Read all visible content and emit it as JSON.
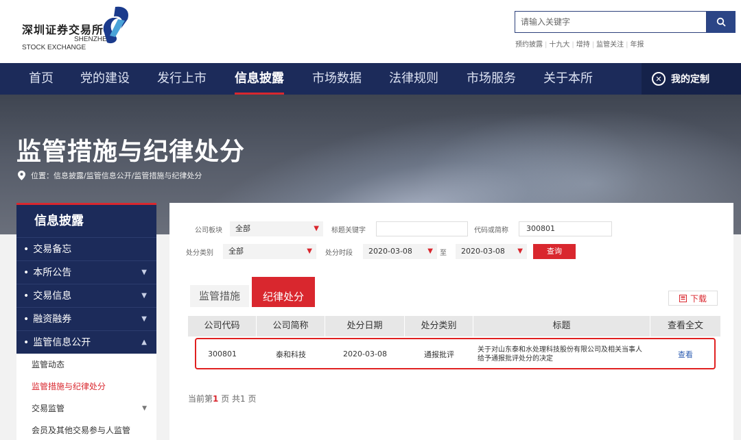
{
  "header": {
    "logo_cn": "深圳证券交易所",
    "logo_en1": "SHENZHEN",
    "logo_en2": "STOCK EXCHANGE",
    "search_placeholder": "请输入关键字",
    "quick_links": [
      "预约披露",
      "十九大",
      "增持",
      "监管关注",
      "年报"
    ]
  },
  "nav": {
    "items": [
      "首页",
      "党的建设",
      "发行上市",
      "信息披露",
      "市场数据",
      "法律规则",
      "市场服务",
      "关于本所"
    ],
    "active_index": 3,
    "custom": "我的定制"
  },
  "banner": {
    "title": "监管措施与纪律处分",
    "breadcrumb": "位置：信息披露/监管信息公开/监管措施与纪律处分"
  },
  "sidebar": {
    "head": "信息披露",
    "items": [
      {
        "label": "交易备忘",
        "arrow": ""
      },
      {
        "label": "本所公告",
        "arrow": "▼"
      },
      {
        "label": "交易信息",
        "arrow": "▼"
      },
      {
        "label": "融资融券",
        "arrow": "▼"
      },
      {
        "label": "监管信息公开",
        "arrow": "▲"
      }
    ],
    "sub_items": [
      {
        "label": "监管动态",
        "active": false,
        "arrow": ""
      },
      {
        "label": "监管措施与纪律处分",
        "active": true,
        "arrow": ""
      },
      {
        "label": "交易监管",
        "active": false,
        "arrow": "▼"
      },
      {
        "label": "会员及其他交易参与人监管",
        "active": false,
        "arrow": ""
      }
    ]
  },
  "filters": {
    "board_label": "公司板块",
    "board_value": "全部",
    "keyword_label": "标题关键字",
    "keyword_value": "",
    "code_label": "代码或简称",
    "code_value": "300801",
    "category_label": "处分类别",
    "category_value": "全部",
    "period_label": "处分时段",
    "date_from": "2020-03-08",
    "to_label": "至",
    "date_to": "2020-03-08",
    "query_button": "查询"
  },
  "tabs": {
    "inactive": "监管措施",
    "active": "纪律处分",
    "download": "下载"
  },
  "table": {
    "columns": [
      "公司代码",
      "公司简称",
      "处分日期",
      "处分类别",
      "标题",
      "查看全文"
    ],
    "rows": [
      {
        "code": "300801",
        "name": "泰和科技",
        "date": "2020-03-08",
        "category": "通报批评",
        "title": "关于对山东泰和水处理科技股份有限公司及相关当事人给予通报批评处分的决定",
        "view": "查看"
      }
    ]
  },
  "pager": {
    "prefix": "当前第",
    "current": "1",
    "mid": "页 共",
    "total": "1",
    "suffix": "页"
  },
  "colors": {
    "nav_bg": "#1c2b5a",
    "accent_red": "#d9272e",
    "link_blue": "#2b5bb0"
  }
}
